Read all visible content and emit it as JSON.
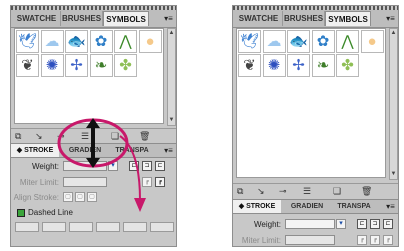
{
  "tabs": {
    "swatches": "SWATCHE",
    "brushes": "BRUSHES",
    "symbols": "SYMBOLS"
  },
  "menu_icon": "panel-menu-icon",
  "symbols": [
    {
      "name": "bird-icon",
      "color": "#3b7fd1"
    },
    {
      "name": "cloud-icon",
      "color": "#9ec8ee"
    },
    {
      "name": "fish-icon",
      "color": "#d4a070"
    },
    {
      "name": "flower-icon",
      "color": "#2f7fc8"
    },
    {
      "name": "grass-icon",
      "color": "#3c8a2a"
    },
    {
      "name": "sun-icon",
      "color": "#f5c98a"
    },
    {
      "name": "leaf-icon",
      "color": "#444444"
    },
    {
      "name": "blue-flower-icon",
      "color": "#2d4fbf"
    },
    {
      "name": "pinwheel-icon",
      "color": "#3d62c8"
    },
    {
      "name": "leaf-stem-icon",
      "color": "#3f7e2a"
    },
    {
      "name": "clover-icon",
      "color": "#8fbf55"
    }
  ],
  "library_icons": [
    "library-icon",
    "place-symbol-icon",
    "break-link-icon",
    "symbol-options-icon",
    "new-symbol-icon",
    "delete-icon"
  ],
  "stroke_tabs": {
    "stroke": "STROKE",
    "gradient": "GRADIEN",
    "transparency": "TRANSPA"
  },
  "stroke": {
    "weight_label": "Weight:",
    "miter_label": "Miter Limit:",
    "align_label": "Align Stroke:",
    "dashed_label": "Dashed Line"
  },
  "annotation": {
    "arrow_color": "#c8186a",
    "arrow_note": "drag-handle"
  }
}
